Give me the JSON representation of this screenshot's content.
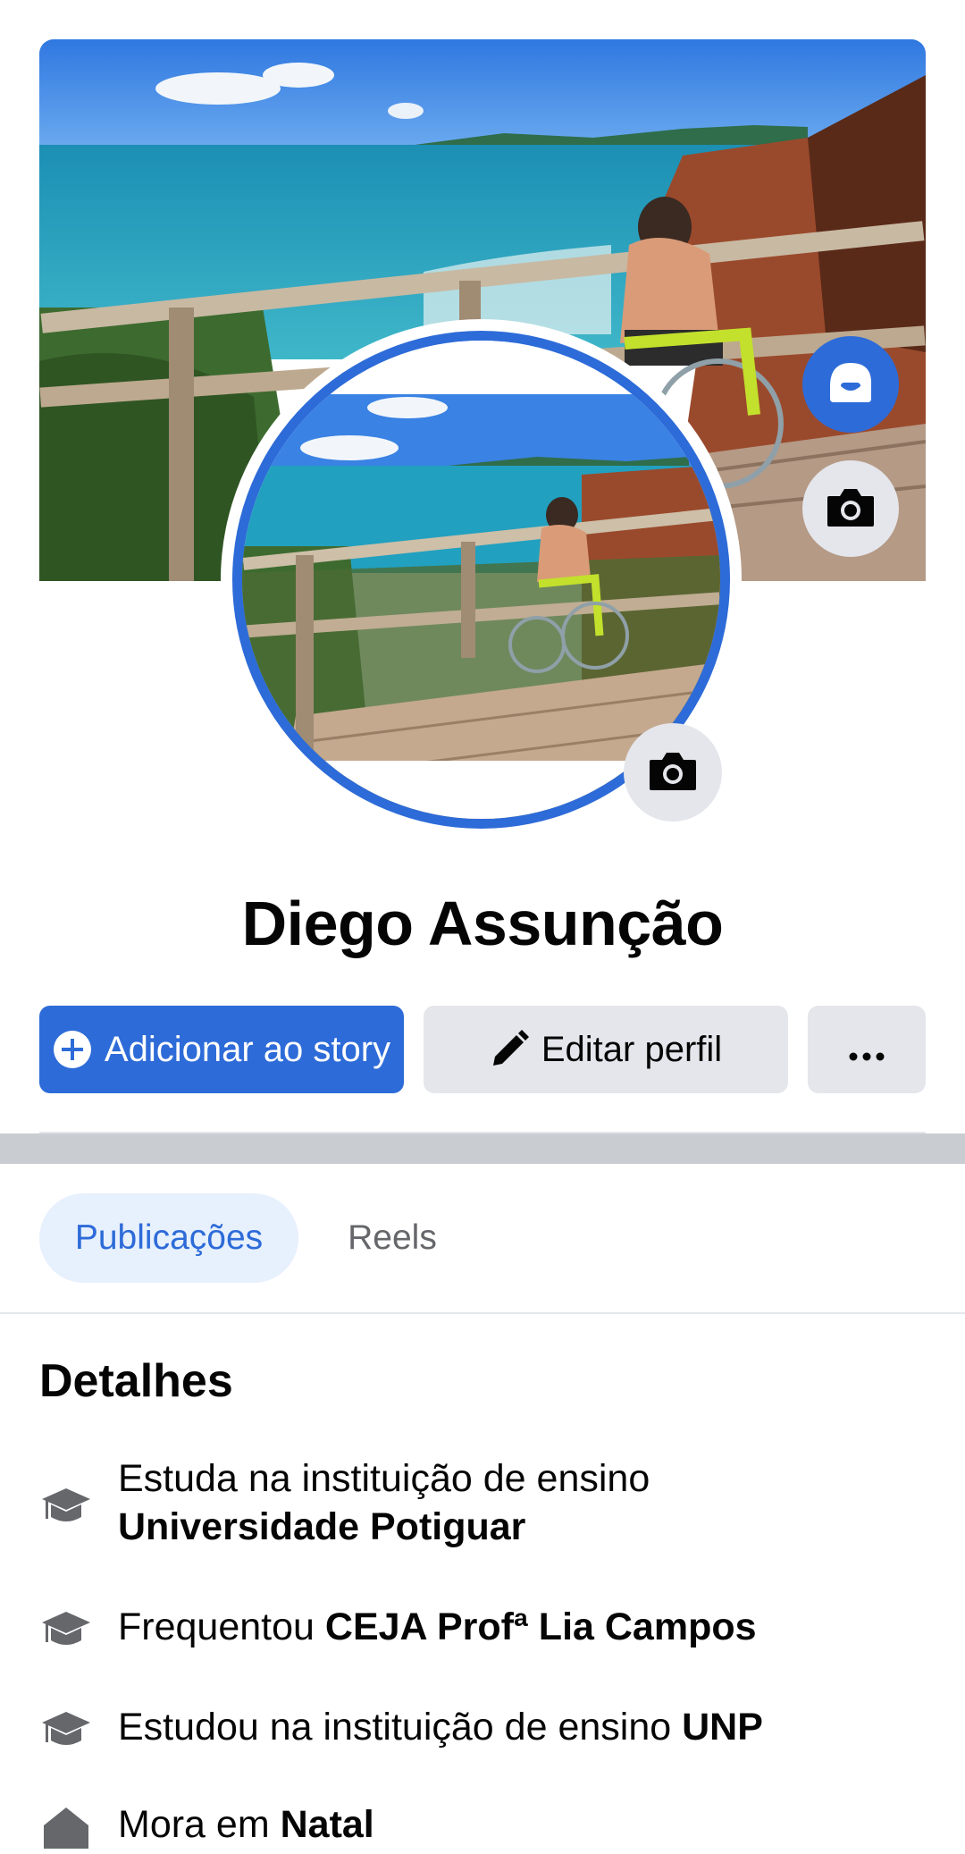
{
  "profile": {
    "name": "Diego Assunção"
  },
  "icons": {
    "avatar_button": "avatar-icon",
    "cover_camera": "camera-icon",
    "profile_camera": "camera-icon",
    "add_story": "plus-circle-icon",
    "edit_profile": "pencil-icon",
    "more": "more-dots-icon",
    "detail": "graduation-cap-icon",
    "home": "home-icon"
  },
  "actions": {
    "add_story_label": "Adicionar ao story",
    "edit_profile_label": "Editar perfil",
    "more_label": "···"
  },
  "tabs": [
    {
      "label": "Publicações",
      "active": true
    },
    {
      "label": "Reels",
      "active": false
    }
  ],
  "details": {
    "title": "Detalhes",
    "items": [
      {
        "prefix": "Estuda na instituição de ensino",
        "bold": "Universidade Potiguar"
      },
      {
        "prefix": "Frequentou",
        "bold": "CEJA Profª Lia Campos"
      },
      {
        "prefix": "Estudou na instituição de ensino",
        "bold": "UNP"
      },
      {
        "prefix": "Mora em",
        "bold": "Natal"
      }
    ]
  },
  "colors": {
    "accent": "#2d6bd8",
    "button_gray": "#e4e6eb",
    "tab_active_bg": "#e7f0fd",
    "divider": "#c9ccd1"
  }
}
